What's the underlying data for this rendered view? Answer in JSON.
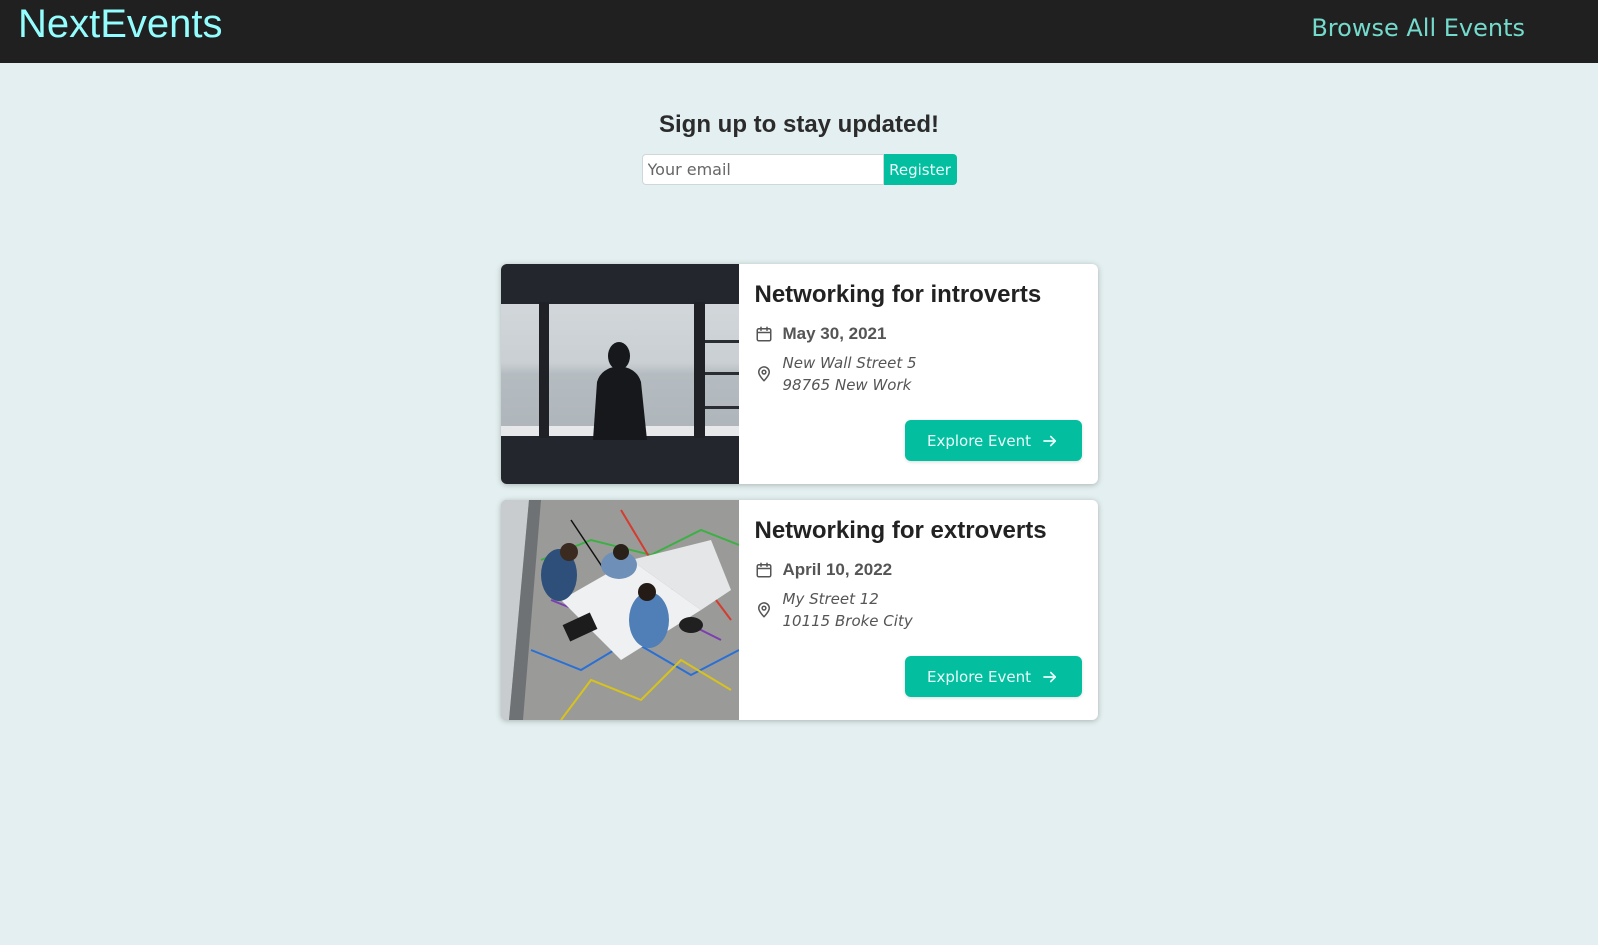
{
  "header": {
    "logo": "NextEvents",
    "nav_link": "Browse All Events"
  },
  "signup": {
    "title": "Sign up to stay updated!",
    "email_placeholder": "Your email",
    "email_value": "",
    "register_label": "Register"
  },
  "events": [
    {
      "title": "Networking for introverts",
      "date": "May 30, 2021",
      "address_line1": "New Wall Street 5",
      "address_line2": "98765 New Work",
      "button_label": "Explore Event",
      "icons": {
        "date": "calendar-icon",
        "address": "location-pin-icon",
        "button": "arrow-right-icon"
      },
      "image": "person sitting alone looking at the sea"
    },
    {
      "title": "Networking for extroverts",
      "date": "April 10, 2022",
      "address_line1": "My Street 12",
      "address_line2": "10115 Broke City",
      "button_label": "Explore Event",
      "icons": {
        "date": "calendar-icon",
        "address": "location-pin-icon",
        "button": "arrow-right-icon"
      },
      "image": "group of people working together at a table"
    }
  ],
  "colors": {
    "header_bg": "#202020",
    "logo": "#94fdfd",
    "nav_link": "#74dacc",
    "page_bg": "#e3eff0",
    "accent": "#03be9f"
  }
}
